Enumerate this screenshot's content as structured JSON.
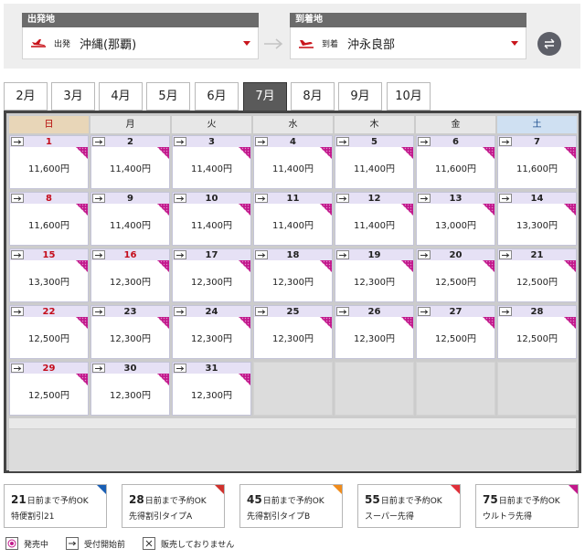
{
  "route": {
    "departure": {
      "header": "出発地",
      "kind": "出発",
      "name": "沖縄(那覇)"
    },
    "arrival": {
      "header": "到着地",
      "kind": "到着",
      "name": "沖永良部"
    }
  },
  "months": [
    "2月",
    "3月",
    "4月",
    "5月",
    "6月",
    "7月",
    "8月",
    "9月",
    "10月"
  ],
  "active_month": "7月",
  "weekdays": [
    "日",
    "月",
    "火",
    "水",
    "木",
    "金",
    "土"
  ],
  "days": [
    {
      "day": "1",
      "price": "11,600円",
      "red": true
    },
    {
      "day": "2",
      "price": "11,400円"
    },
    {
      "day": "3",
      "price": "11,400円"
    },
    {
      "day": "4",
      "price": "11,400円"
    },
    {
      "day": "5",
      "price": "11,400円"
    },
    {
      "day": "6",
      "price": "11,600円"
    },
    {
      "day": "7",
      "price": "11,600円"
    },
    {
      "day": "8",
      "price": "11,600円",
      "red": true
    },
    {
      "day": "9",
      "price": "11,400円"
    },
    {
      "day": "10",
      "price": "11,400円"
    },
    {
      "day": "11",
      "price": "11,400円"
    },
    {
      "day": "12",
      "price": "11,400円"
    },
    {
      "day": "13",
      "price": "13,000円"
    },
    {
      "day": "14",
      "price": "13,300円"
    },
    {
      "day": "15",
      "price": "13,300円",
      "red": true
    },
    {
      "day": "16",
      "price": "12,300円",
      "red": true
    },
    {
      "day": "17",
      "price": "12,300円"
    },
    {
      "day": "18",
      "price": "12,300円"
    },
    {
      "day": "19",
      "price": "12,300円"
    },
    {
      "day": "20",
      "price": "12,500円"
    },
    {
      "day": "21",
      "price": "12,500円"
    },
    {
      "day": "22",
      "price": "12,500円",
      "red": true
    },
    {
      "day": "23",
      "price": "12,300円"
    },
    {
      "day": "24",
      "price": "12,300円"
    },
    {
      "day": "25",
      "price": "12,300円"
    },
    {
      "day": "26",
      "price": "12,300円"
    },
    {
      "day": "27",
      "price": "12,500円"
    },
    {
      "day": "28",
      "price": "12,500円"
    },
    {
      "day": "29",
      "price": "12,500円",
      "red": true
    },
    {
      "day": "30",
      "price": "12,300円"
    },
    {
      "day": "31",
      "price": "12,300円"
    }
  ],
  "discounts": [
    {
      "days": "21",
      "suffix": "日前まで予約OK",
      "name": "特便割引21",
      "color": "#1a5fb4"
    },
    {
      "days": "28",
      "suffix": "日前まで予約OK",
      "name": "先得割引タイプA",
      "color": "#d0312d"
    },
    {
      "days": "45",
      "suffix": "日前まで予約OK",
      "name": "先得割引タイプB",
      "color": "#f08c1c"
    },
    {
      "days": "55",
      "suffix": "日前まで予約OK",
      "name": "スーパー先得",
      "color": "#e0303a"
    },
    {
      "days": "75",
      "suffix": "日前まで予約OK",
      "name": "ウルトラ先得",
      "color": "#c2188b"
    }
  ],
  "status_keys": [
    {
      "label": "発売中",
      "icon": "on-sale-icon"
    },
    {
      "label": "受付開始前",
      "icon": "before-open-icon"
    },
    {
      "label": "販売しておりません",
      "icon": "not-sold-icon"
    }
  ],
  "colors": {
    "accent": "#c9161d",
    "ultra_corner": "#c2188b"
  }
}
